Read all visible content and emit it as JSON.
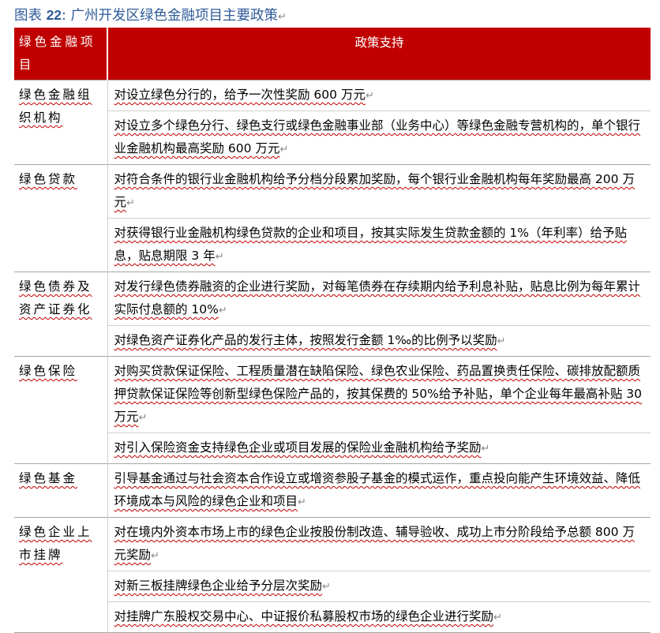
{
  "title": {
    "prefix": "图表 ",
    "number": "22",
    "text": ": 广州开发区绿色金融项目主要政策"
  },
  "table": {
    "headers": [
      "绿色金融项目",
      "政策支持"
    ],
    "groups": [
      {
        "category": "绿色金融组织机构",
        "policies": [
          "对设立绿色分行的，给予一次性奖励 600 万元",
          "对设立多个绿色分行、绿色支行或绿色金融事业部（业务中心）等绿色金融专营机构的，单个银行业金融机构最高奖励 600 万元"
        ]
      },
      {
        "category": "绿色贷款",
        "policies": [
          "对符合条件的银行业金融机构给予分档分段累加奖励，每个银行业金融机构每年奖励最高 200 万元",
          "对获得银行业金融机构绿色贷款的企业和项目，按其实际发生贷款金额的 1%（年利率）给予贴息，贴息期限 3 年"
        ]
      },
      {
        "category": "绿色债券及资产证券化",
        "policies": [
          "对发行绿色债券融资的企业进行奖励，对每笔债券在存续期内给予利息补贴，贴息比例为每年累计实际付息额的 10%",
          "对绿色资产证券化产品的发行主体，按照发行金额 1‰的比例予以奖励"
        ]
      },
      {
        "category": "绿色保险",
        "policies": [
          "对购买贷款保证保险、工程质量潜在缺陷保险、绿色农业保险、药品置换责任保险、碳排放配额质押贷款保证保险等创新型绿色保险产品的，按其保费的 50%给予补贴，单个企业每年最高补贴 30 万元",
          "对引入保险资金支持绿色企业或项目发展的保险业金融机构给予奖励"
        ]
      },
      {
        "category": "绿色基金",
        "policies": [
          "引导基金通过与社会资本合作设立或增资参股子基金的模式运作，重点投向能产生环境效益、降低环境成本与风险的绿色企业和项目"
        ]
      },
      {
        "category": "绿色企业上市挂牌",
        "policies": [
          "对在境内外资本市场上市的绿色企业按股份制改造、辅导验收、成功上市分阶段给予总额 800 万元奖励",
          "对新三板挂牌绿色企业给予分层次奖励",
          "对挂牌广东股权交易中心、中证报价私募股权市场的绿色企业进行奖励"
        ]
      }
    ]
  },
  "colors": {
    "title": "#2e5a98",
    "header_bg": "#c00000",
    "header_text": "#ffffff",
    "underline": "#c00000"
  }
}
